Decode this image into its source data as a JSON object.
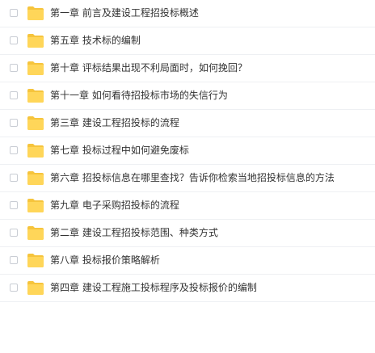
{
  "colors": {
    "folder_body": "#FFD659",
    "folder_tab": "#F6C43C",
    "text": "#333333",
    "divider": "#EEF0F3"
  },
  "files": [
    {
      "name": "第一章 前言及建设工程招投标概述",
      "icon": "folder-icon"
    },
    {
      "name": "第五章 技术标的编制",
      "icon": "folder-icon"
    },
    {
      "name": "第十章 评标结果出现不利局面时，如何挽回？",
      "icon": "folder-icon"
    },
    {
      "name": "第十一章 如何看待招投标市场的失信行为",
      "icon": "folder-icon"
    },
    {
      "name": "第三章 建设工程招投标的流程",
      "icon": "folder-icon"
    },
    {
      "name": "第七章 投标过程中如何避免废标",
      "icon": "folder-icon"
    },
    {
      "name": "第六章 招投标信息在哪里查找？告诉你检索当地招投标信息的方法",
      "icon": "folder-icon"
    },
    {
      "name": "第九章 电子采购招投标的流程",
      "icon": "folder-icon"
    },
    {
      "name": "第二章 建设工程招投标范围、种类方式",
      "icon": "folder-icon"
    },
    {
      "name": "第八章 投标报价策略解析",
      "icon": "folder-icon"
    },
    {
      "name": "第四章 建设工程施工投标程序及投标报价的编制",
      "icon": "folder-icon"
    }
  ]
}
